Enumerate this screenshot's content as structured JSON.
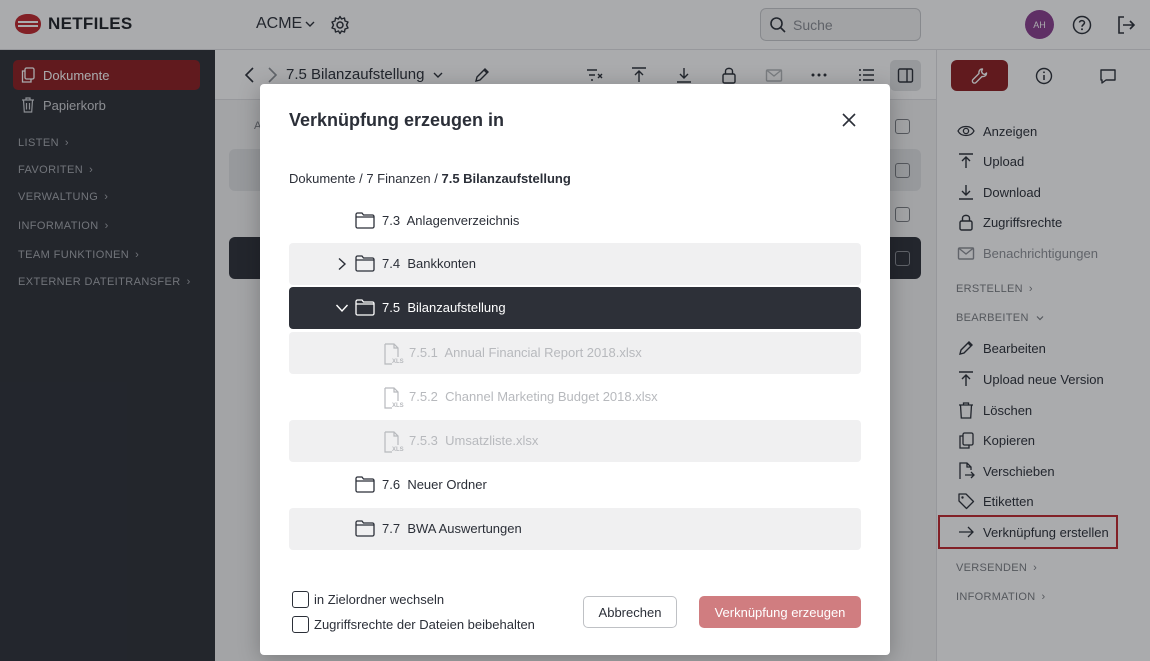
{
  "app": {
    "logo_text": "NETFILES",
    "workspace": "ACME"
  },
  "search": {
    "placeholder": "Suche"
  },
  "user": {
    "initials": "AH"
  },
  "sidebar": {
    "items": [
      {
        "label": "Dokumente"
      },
      {
        "label": "Papierkorb"
      }
    ],
    "sections": [
      "LISTEN",
      "FAVORITEN",
      "VERWALTUNG",
      "INFORMATION",
      "TEAM FUNKTIONEN",
      "EXTERNER DATEITRANSFER"
    ]
  },
  "main": {
    "breadcrumb": "7.5 Bilanzaufstellung",
    "col_initial": "A"
  },
  "right_panel": {
    "items": [
      {
        "label": "Anzeigen"
      },
      {
        "label": "Upload"
      },
      {
        "label": "Download"
      },
      {
        "label": "Zugriffsrechte"
      },
      {
        "label": "Benachrichtigungen"
      }
    ],
    "sections": {
      "erstellen": "ERSTELLEN",
      "bearbeiten": "BEARBEITEN",
      "versenden": "VERSENDEN",
      "information": "INFORMATION"
    },
    "edit_items": [
      {
        "label": "Bearbeiten"
      },
      {
        "label": "Upload neue Version"
      },
      {
        "label": "Löschen"
      },
      {
        "label": "Kopieren"
      },
      {
        "label": "Verschieben"
      },
      {
        "label": "Etiketten"
      },
      {
        "label": "Verknüpfung erstellen"
      }
    ]
  },
  "modal": {
    "title": "Verknüpfung erzeugen in",
    "path_prefix": "Dokumente / 7 Finanzen / ",
    "path_current": "7.5 Bilanzaufstellung",
    "tree": [
      {
        "number": "7.3",
        "label": "Anlagenverzeichnis"
      },
      {
        "number": "7.4",
        "label": "Bankkonten"
      },
      {
        "number": "7.5",
        "label": "Bilanzaufstellung"
      },
      {
        "number": "7.5.1",
        "label": "Annual Financial Report 2018.xlsx",
        "file_badge": "XLS"
      },
      {
        "number": "7.5.2",
        "label": "Channel Marketing Budget 2018.xlsx",
        "file_badge": "XLS"
      },
      {
        "number": "7.5.3",
        "label": "Umsatzliste.xlsx",
        "file_badge": "XLS"
      },
      {
        "number": "7.6",
        "label": "Neuer Ordner"
      },
      {
        "number": "7.7",
        "label": "BWA Auswertungen"
      }
    ],
    "options": {
      "switch_folder": "in Zielordner wechseln",
      "keep_rights": "Zugriffsrechte der Dateien beibehalten"
    },
    "buttons": {
      "cancel": "Abbrechen",
      "confirm": "Verknüpfung erzeugen"
    }
  },
  "colors": {
    "brand": "#8e1d20",
    "sidebar_bg": "#2c2f36",
    "selected_row": "#2d3038",
    "confirm_button": "#d07d80",
    "highlight": "#c0272d",
    "avatar": "#8a3d8f"
  }
}
